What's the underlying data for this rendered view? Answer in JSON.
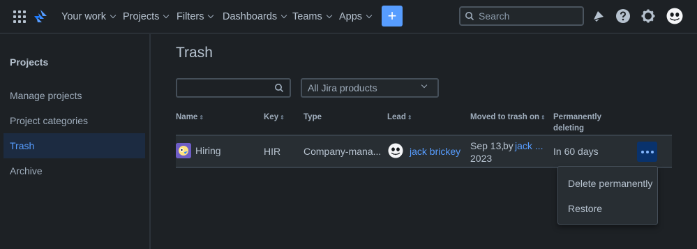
{
  "nav": {
    "items": [
      {
        "label": "Your work"
      },
      {
        "label": "Projects"
      },
      {
        "label": "Filters"
      },
      {
        "label": "Dashboards"
      },
      {
        "label": "Teams"
      },
      {
        "label": "Apps"
      }
    ],
    "create_label": "+",
    "search_placeholder": "Search",
    "icons": [
      "app-switcher-icon",
      "jira-logo-icon",
      "notifications-icon",
      "help-icon",
      "settings-icon",
      "avatar"
    ]
  },
  "sidebar": {
    "title": "Projects",
    "items": [
      {
        "label": "Manage projects"
      },
      {
        "label": "Project categories"
      },
      {
        "label": "Trash"
      },
      {
        "label": "Archive"
      }
    ],
    "active_index": 2
  },
  "main": {
    "title": "Trash",
    "filter_value": "",
    "product_select": "All Jira products",
    "columns": {
      "name": "Name",
      "key": "Key",
      "type": "Type",
      "lead": "Lead",
      "moved": "Moved to trash on",
      "perm_line1": "Permanently",
      "perm_line2": "deleting"
    },
    "rows": [
      {
        "name": "Hiring",
        "key": "HIR",
        "type": "Company-mana...",
        "lead": "jack brickey",
        "moved_date": "Sep 13,",
        "moved_year": "2023",
        "moved_by": "by",
        "moved_by_user": "jack ...",
        "perm": "In 60 days"
      }
    ]
  },
  "menu": {
    "items": [
      {
        "label": "Delete permanently"
      },
      {
        "label": "Restore"
      }
    ]
  },
  "colors": {
    "background": "#1d2125",
    "accent": "#579dff",
    "active_bg": "#1c2b41",
    "row_bg": "#282e33"
  }
}
